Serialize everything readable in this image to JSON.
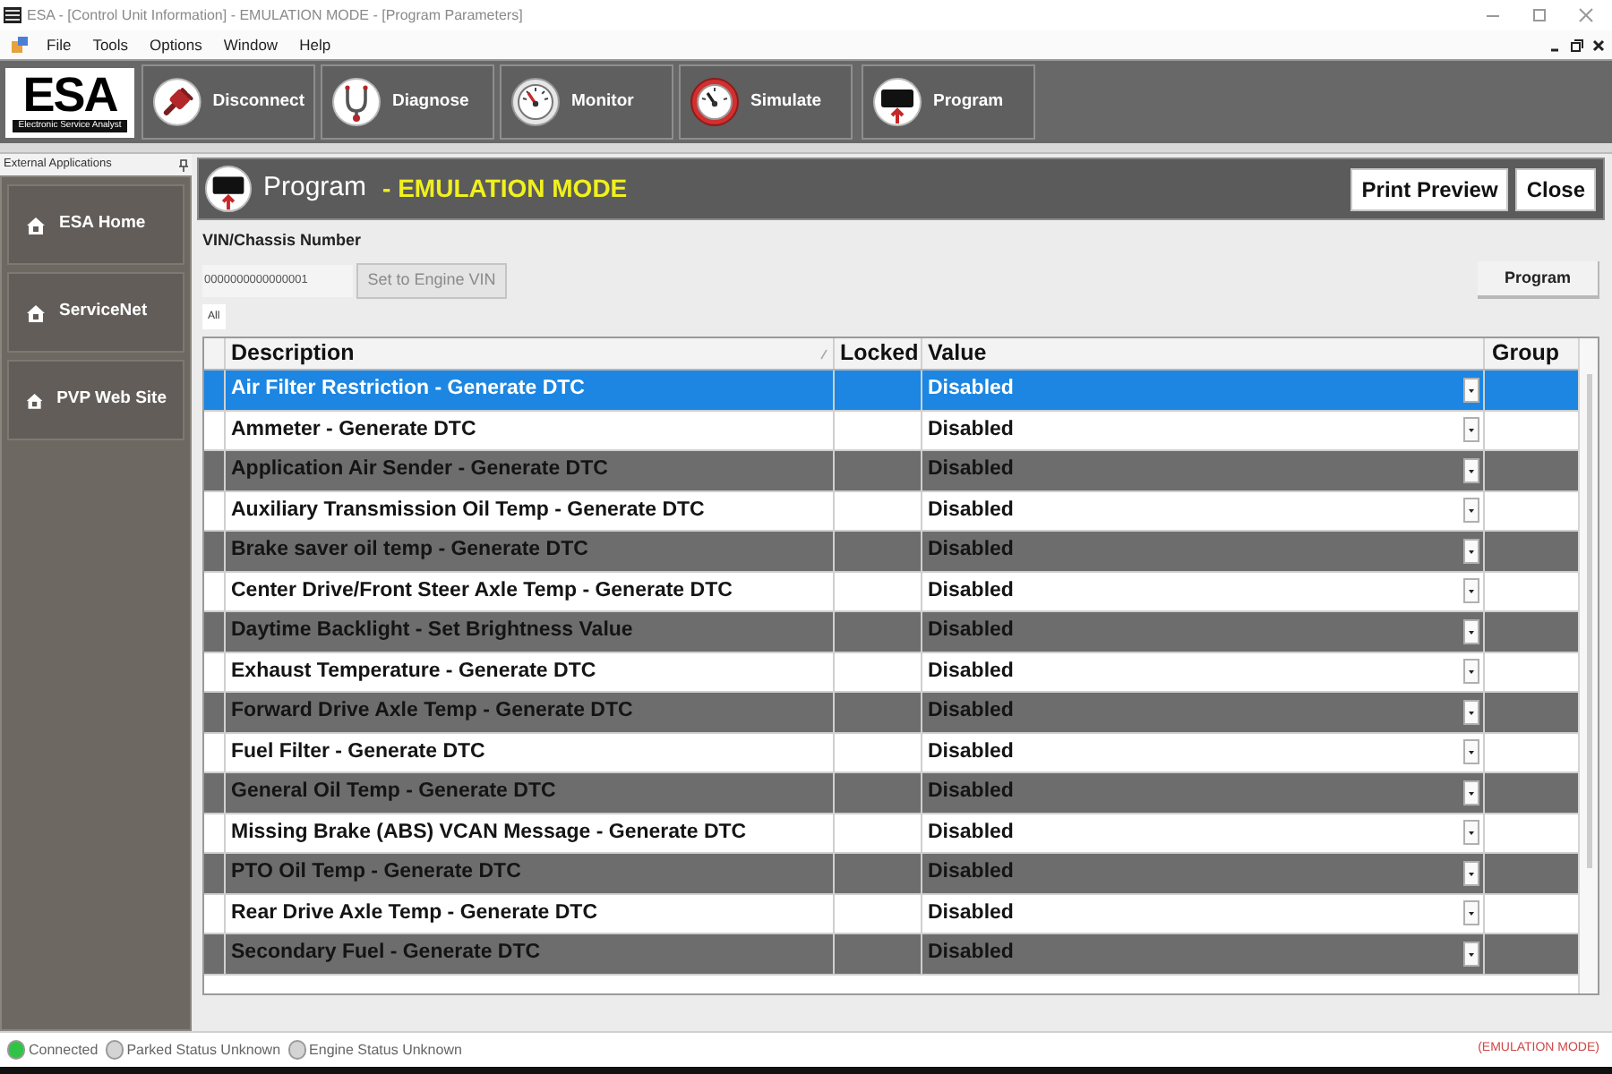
{
  "window": {
    "title": "ESA - [Control Unit Information] - EMULATION MODE - [Program Parameters]"
  },
  "menu": [
    "File",
    "Tools",
    "Options",
    "Window",
    "Help"
  ],
  "logo": {
    "name": "ESA",
    "tagline": "Electronic Service Analyst"
  },
  "toolbar": [
    {
      "label": "Disconnect",
      "kind": "disconnect"
    },
    {
      "label": "Diagnose",
      "kind": "diagnose"
    },
    {
      "label": "Monitor",
      "kind": "monitor"
    },
    {
      "label": "Simulate",
      "kind": "simulate"
    },
    {
      "label": "Program",
      "kind": "program"
    }
  ],
  "sidebar": {
    "title": "External Applications",
    "items": [
      "ESA Home",
      "ServiceNet",
      "PVP Web Site"
    ]
  },
  "panel": {
    "title": "Program",
    "mode": "- EMULATION MODE",
    "buttons": [
      "Print Preview",
      "Close"
    ]
  },
  "vin": {
    "label": "VIN/Chassis Number",
    "value": "0000000000000001",
    "button": "Set to Engine VIN",
    "program_button": "Program"
  },
  "tabs": [
    {
      "label": "All",
      "selected": true
    }
  ],
  "table": {
    "columns": [
      "Description",
      "Locked",
      "Value",
      "Group"
    ],
    "rows": [
      {
        "description": "Air Filter Restriction - Generate DTC",
        "value": "Disabled",
        "selected": true
      },
      {
        "description": "Ammeter - Generate DTC",
        "value": "Disabled",
        "selected": false
      },
      {
        "description": "Application Air Sender - Generate DTC",
        "value": "Disabled",
        "selected": false
      },
      {
        "description": "Auxiliary Transmission Oil Temp - Generate DTC",
        "value": "Disabled",
        "selected": false
      },
      {
        "description": "Brake saver oil temp - Generate DTC",
        "value": "Disabled",
        "selected": false
      },
      {
        "description": "Center Drive/Front Steer Axle Temp - Generate DTC",
        "value": "Disabled",
        "selected": false
      },
      {
        "description": "Daytime Backlight - Set Brightness Value",
        "value": "Disabled",
        "selected": false
      },
      {
        "description": "Exhaust Temperature - Generate DTC",
        "value": "Disabled",
        "selected": false
      },
      {
        "description": "Forward Drive Axle Temp - Generate DTC",
        "value": "Disabled",
        "selected": false
      },
      {
        "description": "Fuel Filter - Generate DTC",
        "value": "Disabled",
        "selected": false
      },
      {
        "description": "General Oil Temp - Generate DTC",
        "value": "Disabled",
        "selected": false
      },
      {
        "description": "Missing Brake (ABS) VCAN Message - Generate DTC",
        "value": "Disabled",
        "selected": false
      },
      {
        "description": "PTO Oil Temp - Generate DTC",
        "value": "Disabled",
        "selected": false
      },
      {
        "description": "Rear Drive Axle Temp - Generate DTC",
        "value": "Disabled",
        "selected": false
      },
      {
        "description": "Secondary Fuel - Generate DTC",
        "value": "Disabled",
        "selected": false
      }
    ]
  },
  "status_bar": {
    "items": [
      {
        "label": "Connected",
        "color": "#2fc446"
      },
      {
        "label": "Parked Status Unknown",
        "color": "#d4d4d4"
      },
      {
        "label": "Engine Status Unknown",
        "color": "#d4d4d4"
      }
    ],
    "mode": "(EMULATION MODE)"
  }
}
